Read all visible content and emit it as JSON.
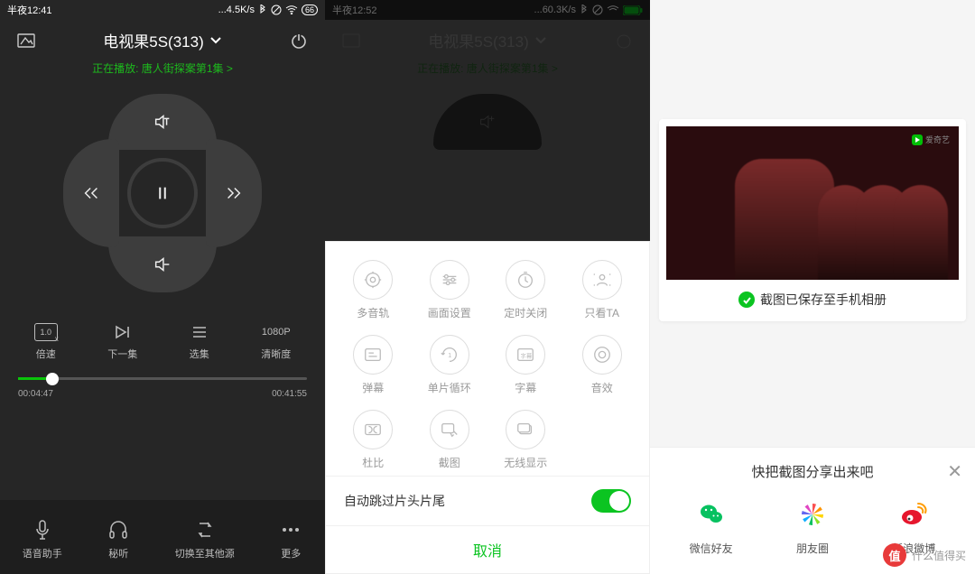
{
  "panel1": {
    "status": {
      "time": "半夜12:41",
      "net": "4.5K/s",
      "battery": "66"
    },
    "device": "电视果5S(313)",
    "nowPlaying": "正在播放: 唐人街探案第1集 >",
    "opts": [
      {
        "icon": "speed-icon",
        "label": "倍速",
        "badge": "1.0"
      },
      {
        "icon": "next-episode-icon",
        "label": "下一集"
      },
      {
        "icon": "episode-list-icon",
        "label": "选集"
      },
      {
        "icon": "quality-icon",
        "label": "清晰度",
        "badge": "1080P"
      }
    ],
    "progress": {
      "elapsed": "00:04:47",
      "total": "00:41:55",
      "pct": 12
    },
    "bottom": [
      {
        "icon": "voice-assist-icon",
        "label": "语音助手"
      },
      {
        "icon": "private-listen-icon",
        "label": "秘听"
      },
      {
        "icon": "switch-source-icon",
        "label": "切换至其他源"
      },
      {
        "icon": "more-icon",
        "label": "更多"
      }
    ]
  },
  "panel2": {
    "status": {
      "time": "半夜12:52",
      "net": "60.3K/s"
    },
    "device": "电视果5S(313)",
    "nowPlaying": "正在播放: 唐人街探案第1集 >",
    "grid": [
      {
        "icon": "multi-audio-icon",
        "label": "多音轨"
      },
      {
        "icon": "picture-settings-icon",
        "label": "画面设置"
      },
      {
        "icon": "sleep-timer-icon",
        "label": "定时关闭"
      },
      {
        "icon": "only-ta-icon",
        "label": "只看TA"
      },
      {
        "icon": "danmu-icon",
        "label": "弹幕"
      },
      {
        "icon": "single-loop-icon",
        "label": "单片循环"
      },
      {
        "icon": "subtitle-icon",
        "label": "字幕"
      },
      {
        "icon": "sound-effect-icon",
        "label": "音效"
      },
      {
        "icon": "dolby-icon",
        "label": "杜比"
      },
      {
        "icon": "screenshot-icon",
        "label": "截图"
      },
      {
        "icon": "wireless-display-icon",
        "label": "无线显示"
      }
    ],
    "switch": {
      "label": "自动跳过片头片尾",
      "on": true
    },
    "cancel": "取消"
  },
  "panel3": {
    "watermark": "爱奇艺",
    "saved": "截图已保存至手机相册",
    "share": {
      "title": "快把截图分享出来吧",
      "items": [
        {
          "icon": "wechat-icon",
          "label": "微信好友",
          "color": "#07c160"
        },
        {
          "icon": "moments-icon",
          "label": "朋友圈",
          "color": "conic"
        },
        {
          "icon": "weibo-icon",
          "label": "新浪微博",
          "color": "#e6162d"
        }
      ]
    }
  },
  "globalMark": {
    "text": "什么值得买",
    "badge": "值"
  }
}
